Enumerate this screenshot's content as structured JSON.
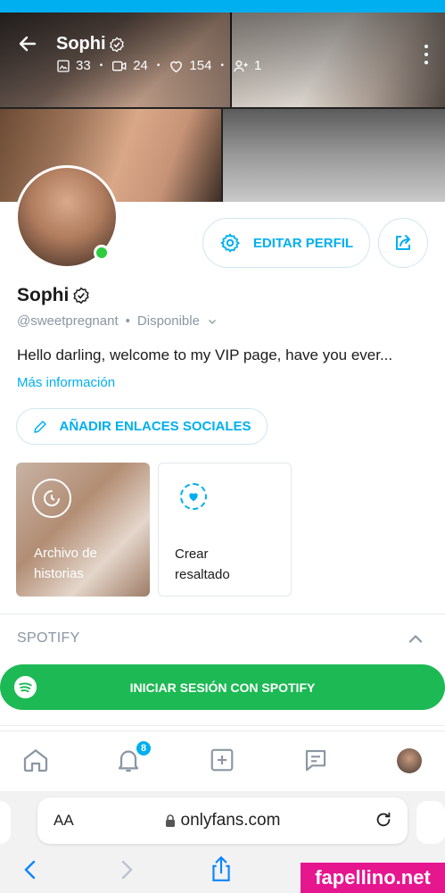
{
  "header": {
    "name": "Sophi",
    "stats": {
      "photos": "33",
      "videos": "24",
      "likes": "154",
      "fans": "1"
    }
  },
  "profile": {
    "name": "Sophi",
    "handle": "@sweetpregnant",
    "status": "Disponible",
    "bio": "Hello darling, welcome to my VIP page, have you ever...",
    "more_info": "Más información",
    "edit_profile_label": "EDITAR PERFIL",
    "add_social_links_label": "AÑADIR ENLACES SOCIALES"
  },
  "highlights": {
    "archive_label_1": "Archivo de",
    "archive_label_2": "historias",
    "create_label_1": "Crear",
    "create_label_2": "resaltado"
  },
  "spotify": {
    "title": "SPOTIFY",
    "login_label": "INICIAR SESIÓN CON SPOTIFY"
  },
  "tabbar": {
    "notifications_badge": "8"
  },
  "browser": {
    "text_size_label": "AA",
    "url": "onlyfans.com"
  },
  "watermark": "fapellino.net",
  "colors": {
    "accent": "#00aff0",
    "online": "#2ecc40",
    "spotify": "#1db954",
    "watermark": "#e6168f"
  }
}
